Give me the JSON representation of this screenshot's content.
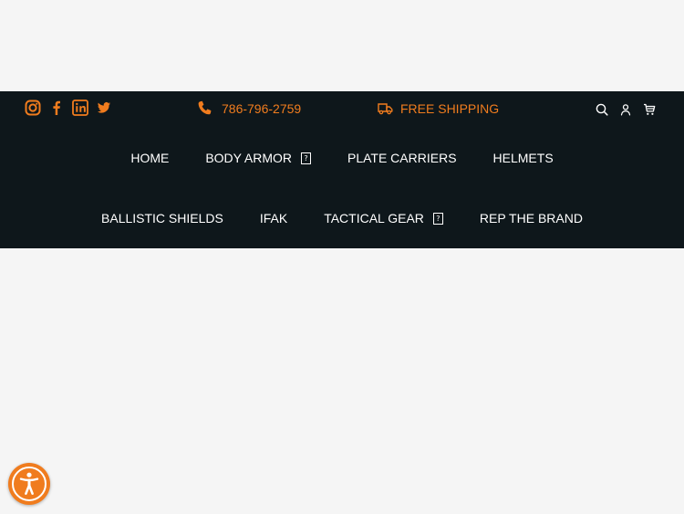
{
  "header": {
    "social": [
      {
        "icon": "instagram-icon"
      },
      {
        "icon": "facebook-icon"
      },
      {
        "icon": "linkedin-icon"
      },
      {
        "icon": "twitter-icon"
      }
    ],
    "phone": {
      "icon": "phone-icon",
      "number": "786-796-2759"
    },
    "shipping": {
      "icon": "truck-icon",
      "label": "FREE SHIPPING"
    },
    "utilities": [
      {
        "icon": "search-icon"
      },
      {
        "icon": "account-icon"
      },
      {
        "icon": "cart-icon"
      }
    ],
    "dropdown_glyph": "?"
  },
  "nav": {
    "row1": [
      {
        "label": "HOME",
        "has_dropdown": false
      },
      {
        "label": "BODY ARMOR",
        "has_dropdown": true
      },
      {
        "label": "PLATE CARRIERS",
        "has_dropdown": false
      },
      {
        "label": "HELMETS",
        "has_dropdown": false
      }
    ],
    "row2": [
      {
        "label": "BALLISTIC SHIELDS",
        "has_dropdown": false
      },
      {
        "label": "IFAK",
        "has_dropdown": false
      },
      {
        "label": "TACTICAL GEAR",
        "has_dropdown": true
      },
      {
        "label": "REP THE BRAND",
        "has_dropdown": false
      }
    ]
  },
  "accessibility": {
    "icon": "accessibility-icon"
  },
  "colors": {
    "accent": "#f07c1e",
    "header_bg": "#0e171b",
    "page_bg": "#f5f5f5",
    "nav_text": "#ffffff"
  }
}
